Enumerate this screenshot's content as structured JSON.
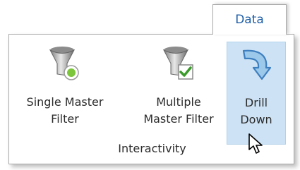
{
  "tab": {
    "label": "Data"
  },
  "buttons": {
    "single_master_filter": {
      "line1": "Single Master",
      "line2": "Filter",
      "icon": "funnel-dot-icon"
    },
    "multiple_master_filter": {
      "line1": "Multiple",
      "line2": "Master Filter",
      "icon": "funnel-checkbox-icon"
    },
    "drill_down": {
      "line1": "Drill",
      "line2": "Down",
      "icon": "curved-arrow-down-icon",
      "state": "hovered"
    }
  },
  "group": {
    "label": "Interactivity"
  },
  "colors": {
    "tab_text": "#1f5fa8",
    "hover_bg": "#cde3f5",
    "hover_border": "#b2d1ea",
    "arrow_fill": "#9cc8ea",
    "arrow_stroke": "#3e7fbf"
  }
}
